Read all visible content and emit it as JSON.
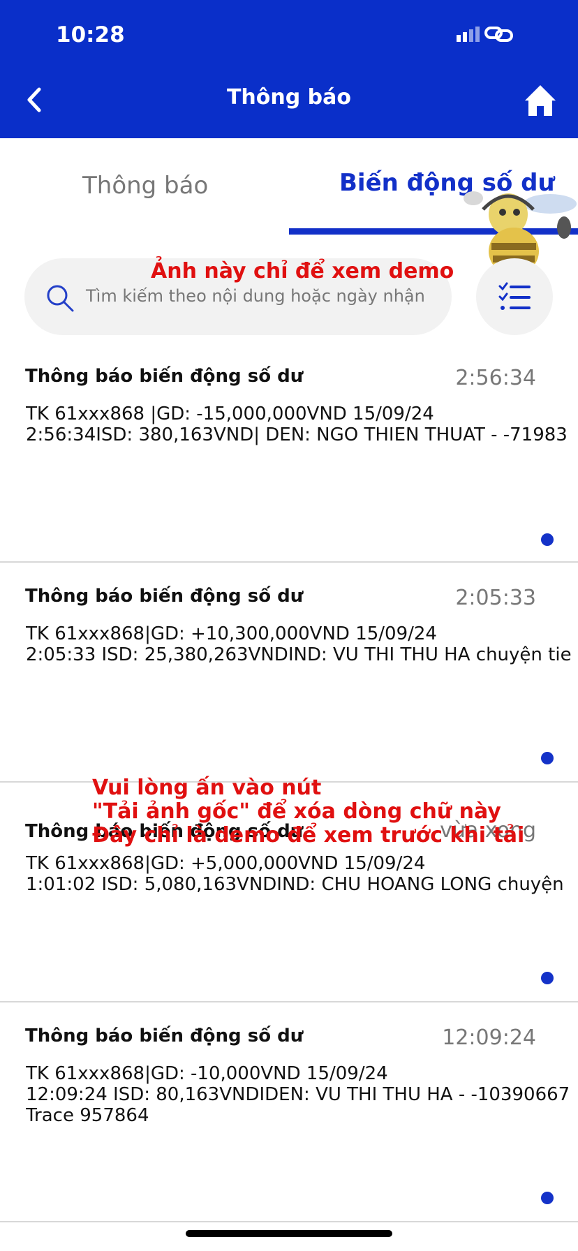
{
  "status_bar": {
    "time": "10:28"
  },
  "header": {
    "title": "Thông báo"
  },
  "tabs": [
    {
      "label": "Thông báo",
      "active": false
    },
    {
      "label": "Biến động số dư",
      "active": true
    }
  ],
  "search": {
    "placeholder": "Tìm kiếm theo nội dung hoặc ngày nhận"
  },
  "notifications": [
    {
      "title": "Thông báo biến động số dư",
      "time": "2:56:34",
      "body": "TK 61xxx868 |GD: -15,000,000VND 15/09/24\n2:56:34ISD: 380,163VND| DEN: NGO THIEN THUAT - -71983",
      "unread": true
    },
    {
      "title": "Thông báo biến động số dư",
      "time": "2:05:33",
      "body": "TK 61xxx868|GD: +10,300,000VND 15/09/24\n2:05:33 ISD: 25,380,263VNDIND: VU THI THU HA chuyện tie",
      "unread": true
    },
    {
      "title": "Thông báo biến động số dư",
      "time": "vừa xong",
      "body": "TK 61xxx868|GD: +5,000,000VND 15/09/24\n1:01:02 ISD: 5,080,163VNDIND: CHU HOANG LONG chuyện",
      "unread": true
    },
    {
      "title": "Thông báo biến động số dư",
      "time": "12:09:24",
      "body": "TK 61xxx868|GD: -10,000VND 15/09/24\n12:09:24 ISD: 80,163VNDIDEN: VU THI THU HA - -10390667\nTrace 957864",
      "unread": true
    }
  ],
  "watermarks": {
    "top": "Ảnh này chỉ để xem demo",
    "middle": [
      "Vui lòng ấn vào nút",
      "\"Tải ảnh gốc\" để xóa dòng chữ này",
      "Đây chỉ là demo để xem trước khi tải"
    ]
  },
  "colors": {
    "brand": "#0a2fc9",
    "accent": "#1230c8",
    "watermark": "#e01010"
  }
}
